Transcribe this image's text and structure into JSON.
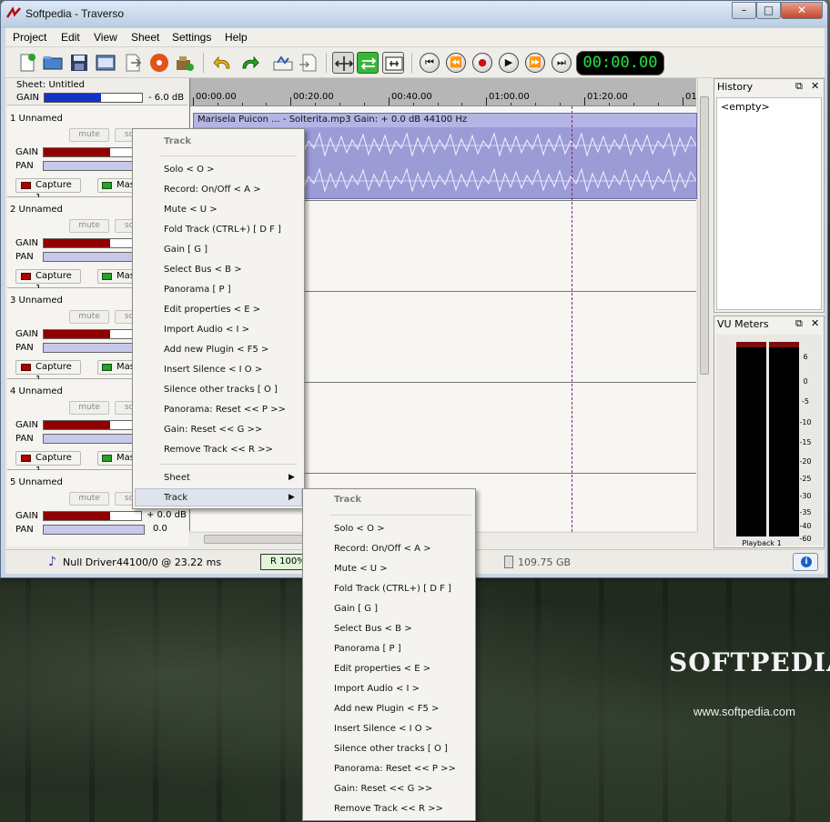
{
  "window": {
    "title": "Softpedia - Traverso"
  },
  "menubar": [
    "Project",
    "Edit",
    "View",
    "Sheet",
    "Settings",
    "Help"
  ],
  "toolbar": {
    "icons": [
      "new-project-icon",
      "open-project-icon",
      "save-icon",
      "sheet-manager-icon",
      "export-icon",
      "burn-cd-icon",
      "plugin-icon",
      "undo-icon",
      "redo-icon",
      "snap-icon",
      "follow-icon",
      "move-icon",
      "fold-icon",
      "zoom-icon"
    ],
    "time": "00:00.00"
  },
  "sheet": {
    "title": "Sheet: Untitled",
    "gain_label": "GAIN",
    "gain_value": "- 6.0 dB",
    "gain_fill_fraction": 0.58
  },
  "tracks": [
    {
      "name": "1  Unnamed",
      "mute": "mute",
      "solo": "solo",
      "gain_label": "GAIN",
      "pan_label": "PAN",
      "capture": "Capture 1",
      "master": "Master",
      "gain_fill_fraction": 0.68
    },
    {
      "name": "2  Unnamed",
      "mute": "mute",
      "solo": "solo",
      "gain_label": "GAIN",
      "pan_label": "PAN",
      "capture": "Capture 1",
      "master": "Master",
      "gain_fill_fraction": 0.68
    },
    {
      "name": "3  Unnamed",
      "mute": "mute",
      "solo": "solo",
      "gain_label": "GAIN",
      "pan_label": "PAN",
      "capture": "Capture 1",
      "master": "Master",
      "gain_fill_fraction": 0.68
    },
    {
      "name": "4  Unnamed",
      "mute": "mute",
      "solo": "solo",
      "gain_label": "GAIN",
      "pan_label": "PAN",
      "capture": "Capture 1",
      "master": "Master",
      "gain_fill_fraction": 0.68
    },
    {
      "name": "5  Unnamed",
      "mute": "mute",
      "solo": "solo",
      "gain_label": "GAIN",
      "pan_label": "PAN",
      "capture": "Capture 1",
      "master": "Master",
      "gain_fill_fraction": 0.68,
      "gain_value": "+ 0.0 dB",
      "pan_value": "0.0"
    }
  ],
  "ruler": [
    "00:00.00",
    "00:20.00",
    "00:40.00",
    "01:00.00",
    "01:20.00",
    "01:"
  ],
  "clip": {
    "label": "Marisela Puicon ... - Solterita.mp3     Gain: + 0.0 dB    44100 Hz"
  },
  "history": {
    "title": "History",
    "empty": "<empty>"
  },
  "vu": {
    "title": "VU Meters",
    "scale": [
      "6",
      "0",
      "-5",
      "-10",
      "-15",
      "-20",
      "-25",
      "-30",
      "-35",
      "-40",
      "-60"
    ],
    "label": "Playback 1"
  },
  "status": {
    "driver": "Null Driver",
    "rate": "44100/0 @ 23.22 ms",
    "rec": "R 100%",
    "disk": "109.75 GB"
  },
  "track_menu": {
    "header": "Track",
    "items": [
      "Solo    < O >",
      "Record: On/Off    < A >",
      "Mute    < U >",
      "Fold Track  (CTRL+) [ D F ]",
      "Gain    [ G ]",
      "Select Bus    < B >",
      "Panorama    [ P ]",
      "Edit properties    < E >",
      "Import Audio    < I >",
      "Add new Plugin    < F5 >",
      "Insert Silence    < I O >",
      "Silence other tracks    [ O ]",
      "Panorama: Reset    << P >>",
      "Gain: Reset    << G >>",
      "Remove Track    << R >>"
    ],
    "submenus": [
      "Sheet",
      "Track"
    ]
  },
  "wallpaper": {
    "brand": "SOFTPEDIA",
    "url": "www.softpedia.com"
  }
}
